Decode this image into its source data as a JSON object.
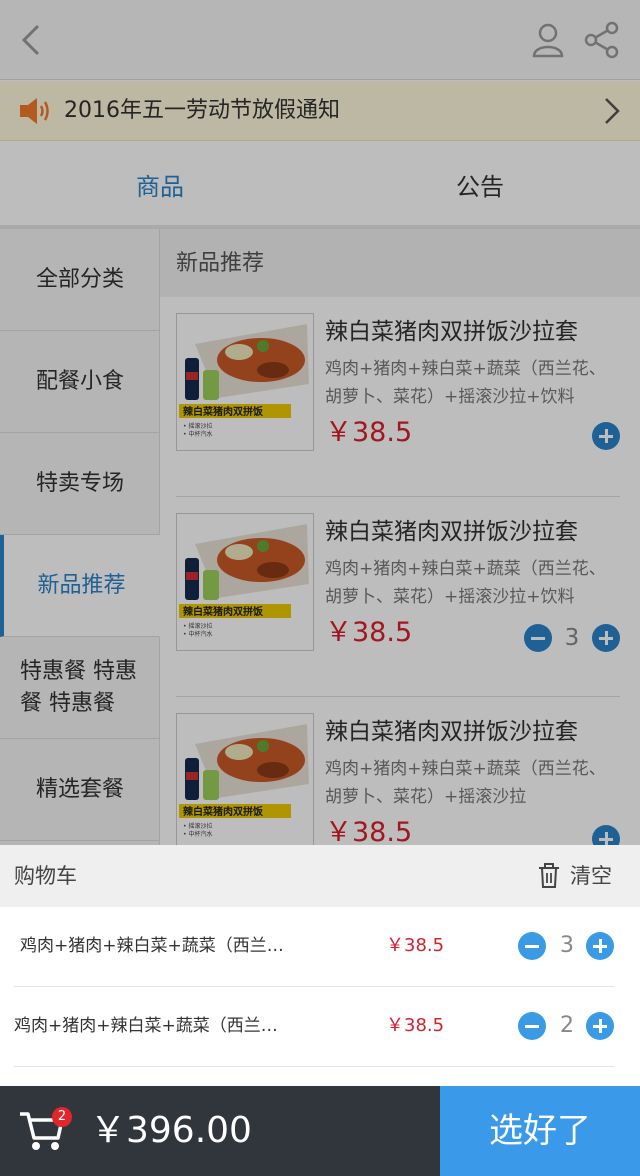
{
  "notice": {
    "text": "2016年五一劳动节放假通知"
  },
  "tabs": [
    {
      "label": "商品",
      "active": true
    },
    {
      "label": "公告",
      "active": false
    }
  ],
  "categories": [
    {
      "label": "全部分类"
    },
    {
      "label": "配餐小食"
    },
    {
      "label": "特卖专场"
    },
    {
      "label": "新品推荐",
      "active": true
    },
    {
      "label": "特惠餐 特惠餐 特惠餐"
    },
    {
      "label": "精选套餐"
    }
  ],
  "section_title": "新品推荐",
  "products": [
    {
      "name": "辣白菜猪肉双拼饭沙拉套",
      "desc": "鸡肉+猪肉+辣白菜+蔬菜（西兰花、胡萝卜、菜花）+摇滚沙拉+饮料",
      "price": "￥38.5",
      "qty": ""
    },
    {
      "name": "辣白菜猪肉双拼饭沙拉套",
      "desc": "鸡肉+猪肉+辣白菜+蔬菜（西兰花、胡萝卜、菜花）+摇滚沙拉+饮料",
      "price": "￥38.5",
      "qty": "3"
    },
    {
      "name": "辣白菜猪肉双拼饭沙拉套",
      "desc": "鸡肉+猪肉+辣白菜+蔬菜（西兰花、胡萝卜、菜花）+摇滚沙拉",
      "price": "￥38.5",
      "qty": ""
    }
  ],
  "thumb": {
    "banner": "辣白菜猪肉双拼饭",
    "bullet1": "• 摇滚沙拉",
    "bullet2": "• 中杯汽水"
  },
  "cart": {
    "title": "购物车",
    "clear_label": "清空",
    "items": [
      {
        "name": "鸡肉+猪肉+辣白菜+蔬菜（西兰花、胡萝卜、菜花）",
        "price": "￥38.5",
        "qty": "3"
      },
      {
        "name": "鸡肉+猪肉+辣白菜+蔬菜（西兰花、胡萝卜、菜花）",
        "price": "￥38.5",
        "qty": "2"
      }
    ]
  },
  "bottom": {
    "badge": "2",
    "total": "￥396.00",
    "confirm_label": "选好了"
  },
  "colors": {
    "accent": "#2a83c9",
    "price": "#d8202b",
    "confirm": "#3a99e8",
    "bar": "#31363c"
  },
  "icons": [
    "back-icon",
    "user-icon",
    "share-icon",
    "speaker-icon",
    "chevron-right-icon",
    "trash-icon",
    "cart-icon",
    "plus-icon",
    "minus-icon"
  ]
}
